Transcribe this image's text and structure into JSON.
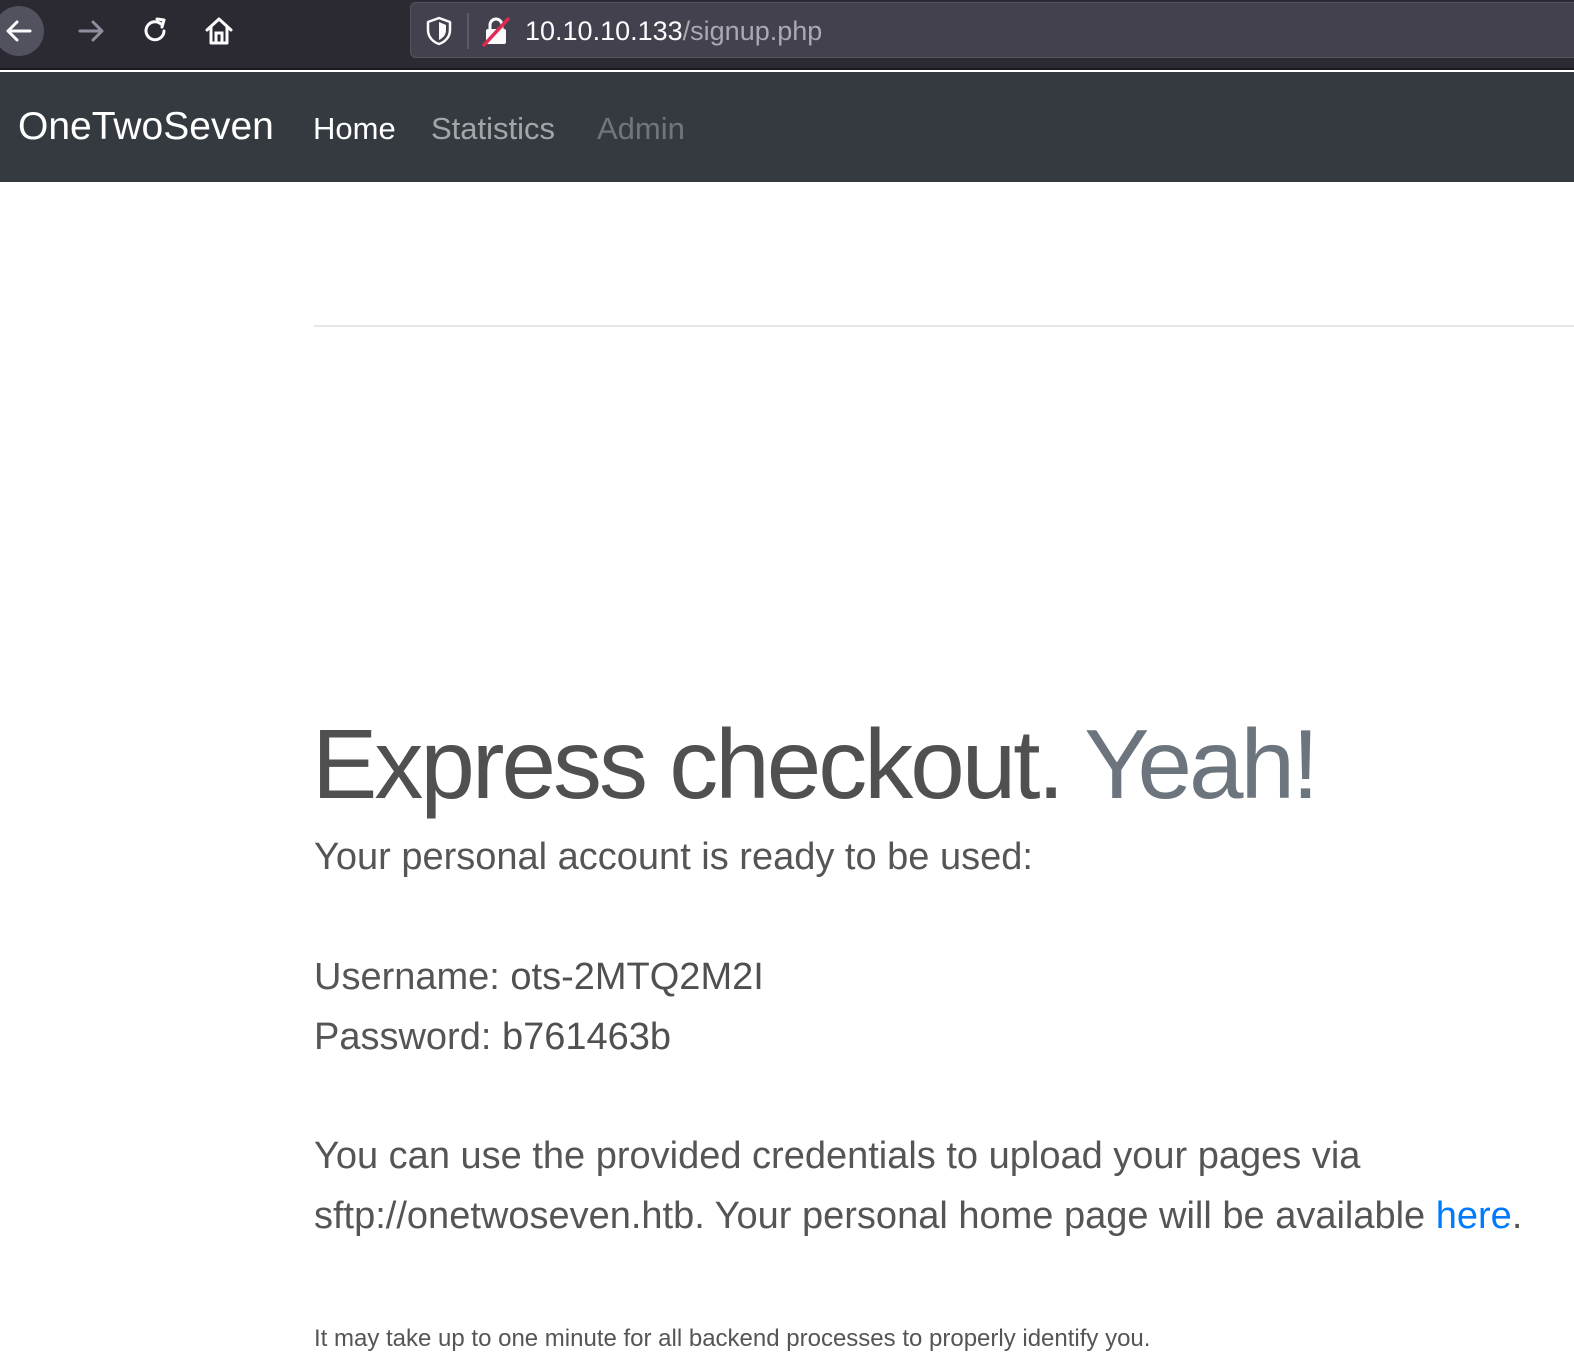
{
  "browser": {
    "url_host": "10.10.10.133",
    "url_path": "/signup.php"
  },
  "navbar": {
    "brand": "OneTwoSeven",
    "links": [
      {
        "label": "Home"
      },
      {
        "label": "Statistics"
      },
      {
        "label": "Admin"
      }
    ]
  },
  "main": {
    "headline_primary": "Express checkout.",
    "headline_secondary": "Yeah!",
    "intro": "Your personal account is ready to be used:",
    "username_label": "Username:",
    "username_value": "ots-2MTQ2M2I",
    "password_label": "Password:",
    "password_value": "b761463b",
    "info_line1": "You can use the provided credentials to upload your pages via",
    "info_line2_prefix": "sftp://onetwoseven.htb. Your personal home page will be available",
    "info_link": "here",
    "info_line2_suffix": ".",
    "note": "It may take up to one minute for all backend processes to properly identify you."
  },
  "colors": {
    "navbar_bg": "#343a40",
    "link": "#007bff",
    "muted": "#6c757d"
  }
}
